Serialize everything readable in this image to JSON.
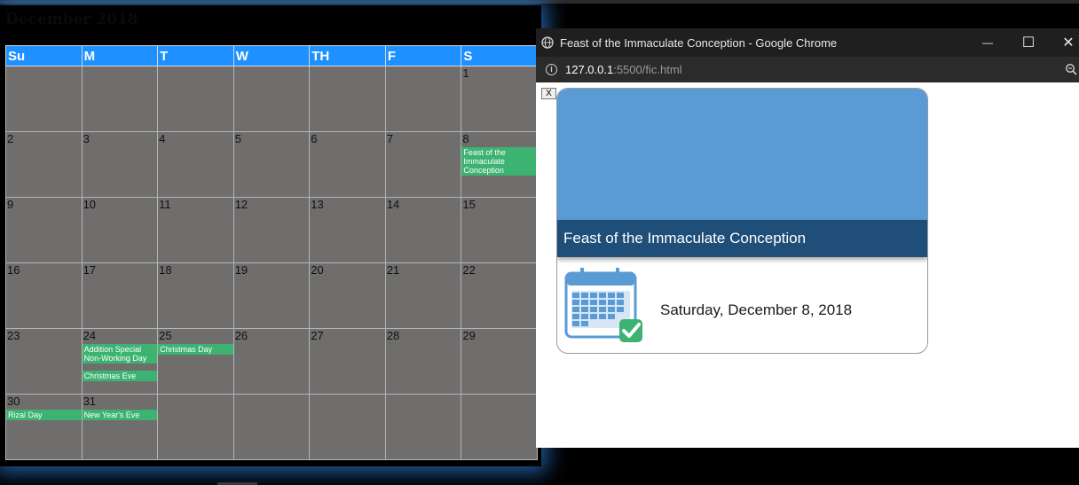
{
  "calendar": {
    "title": "December 2018",
    "weekdays": [
      "Su",
      "M",
      "T",
      "W",
      "TH",
      "F",
      "S"
    ],
    "weeks": [
      [
        {
          "day": ""
        },
        {
          "day": ""
        },
        {
          "day": ""
        },
        {
          "day": ""
        },
        {
          "day": ""
        },
        {
          "day": ""
        },
        {
          "day": "1"
        }
      ],
      [
        {
          "day": "2"
        },
        {
          "day": "3"
        },
        {
          "day": "4"
        },
        {
          "day": "5"
        },
        {
          "day": "6"
        },
        {
          "day": "7"
        },
        {
          "day": "8",
          "events": [
            "Feast of the Immaculate Conception"
          ]
        }
      ],
      [
        {
          "day": "9"
        },
        {
          "day": "10"
        },
        {
          "day": "11"
        },
        {
          "day": "12"
        },
        {
          "day": "13"
        },
        {
          "day": "14"
        },
        {
          "day": "15"
        }
      ],
      [
        {
          "day": "16"
        },
        {
          "day": "17"
        },
        {
          "day": "18"
        },
        {
          "day": "19"
        },
        {
          "day": "20"
        },
        {
          "day": "21"
        },
        {
          "day": "22"
        }
      ],
      [
        {
          "day": "23"
        },
        {
          "day": "24",
          "events": [
            "Addition Special Non-Working Day",
            "Christmas Eve"
          ]
        },
        {
          "day": "25",
          "events": [
            "Christmas Day"
          ]
        },
        {
          "day": "26"
        },
        {
          "day": "27"
        },
        {
          "day": "28"
        },
        {
          "day": "29"
        }
      ],
      [
        {
          "day": "30",
          "events": [
            "Rizal Day"
          ]
        },
        {
          "day": "31",
          "events": [
            "New Year's Eve"
          ]
        },
        {
          "day": ""
        },
        {
          "day": ""
        },
        {
          "day": ""
        },
        {
          "day": ""
        },
        {
          "day": ""
        }
      ]
    ]
  },
  "popup": {
    "window_title": "Feast of the Immaculate Conception - Google Chrome",
    "url_host": "127.0.0.1",
    "url_path": ":5500/fic.html",
    "close_label": "X",
    "card_title": "Feast of the Immaculate Conception",
    "card_date": "Saturday, December 8, 2018",
    "controls": {
      "minimize": "—",
      "maximize": "☐",
      "close": "✕"
    }
  },
  "colors": {
    "header_blue": "#1e90ff",
    "cell_gray": "#706d6d",
    "event_green": "#3cb371",
    "banner_blue": "#5b9bd5",
    "title_navy": "#1f4e79"
  },
  "icons": [
    "globe-icon",
    "info-icon",
    "zoom-icon",
    "calendar-check-icon"
  ]
}
